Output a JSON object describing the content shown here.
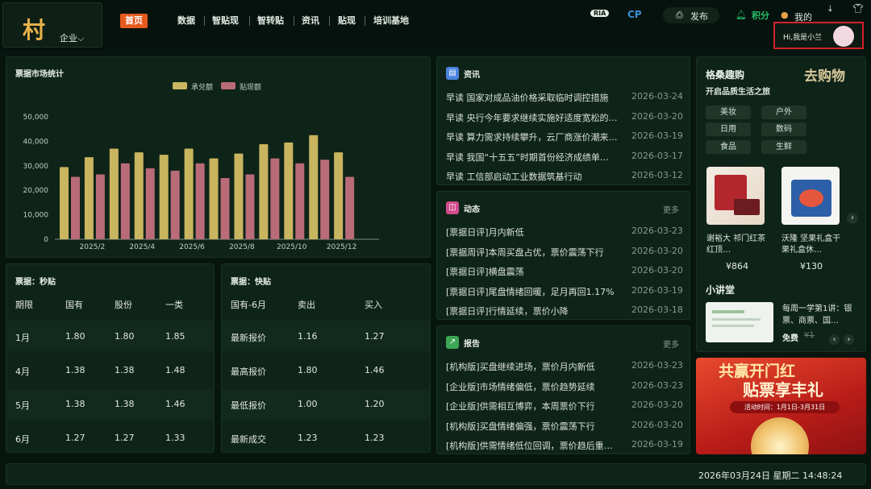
{
  "header": {
    "logo_glyph": "村",
    "logo_label": "企业",
    "nav": [
      "首页",
      "数据",
      "智贴现",
      "智转贴",
      "资讯",
      "贴现",
      "培训基地"
    ],
    "ria": "RIA",
    "cp": "CP",
    "publish": "发布",
    "vip": "积分",
    "mine": "我的",
    "greeting": "Hi,我是小兰"
  },
  "chart_panel": {
    "title": "票据市场统计",
    "legend": [
      "承兑额",
      "贴现额"
    ]
  },
  "chart_data": {
    "type": "bar",
    "title": "票据市场统计",
    "categories": [
      "2025/1",
      "2025/2",
      "2025/3",
      "2025/4",
      "2025/5",
      "2025/6",
      "2025/7",
      "2025/8",
      "2025/9",
      "2025/10",
      "2025/11",
      "2025/12",
      "2026/1"
    ],
    "x_tick_labels": [
      "2025/2",
      "2025/4",
      "2025/6",
      "2025/8",
      "2025/10",
      "2025/12"
    ],
    "series": [
      {
        "name": "承兑额",
        "color": "#c9b55f",
        "values": [
          29500,
          33500,
          37000,
          35500,
          34500,
          37000,
          33000,
          35000,
          38800,
          39500,
          42500,
          35500,
          0
        ]
      },
      {
        "name": "贴现额",
        "color": "#b96b78",
        "values": [
          25500,
          26500,
          31000,
          29000,
          28000,
          31000,
          25000,
          26500,
          33000,
          31000,
          32500,
          25500,
          0
        ]
      }
    ],
    "ylim": [
      0,
      50000
    ],
    "y_ticks": [
      "0",
      "10,000",
      "20,000",
      "30,000",
      "40,000",
      "50,000"
    ],
    "grid": false,
    "legend_position": "top-center"
  },
  "miaotie": {
    "title": "票据：秒贴",
    "headers": [
      "期限",
      "国有",
      "股份",
      "一类"
    ],
    "rows": [
      [
        "1月",
        "1.80",
        "1.80",
        "1.85"
      ],
      [
        "4月",
        "1.38",
        "1.38",
        "1.48"
      ],
      [
        "5月",
        "1.38",
        "1.38",
        "1.46"
      ],
      [
        "6月",
        "1.27",
        "1.27",
        "1.33"
      ]
    ]
  },
  "kuaitie": {
    "title": "票据：快贴",
    "headers": [
      "国有-6月",
      "卖出",
      "买入"
    ],
    "rows": [
      [
        "最新报价",
        "1.16",
        "1.27"
      ],
      [
        "最高报价",
        "1.80",
        "1.46"
      ],
      [
        "最低报价",
        "1.00",
        "1.20"
      ],
      [
        "最新成交",
        "1.23",
        "1.23"
      ]
    ]
  },
  "news": {
    "title": "资讯",
    "items": [
      {
        "text": "早读 国家对成品油价格采取临时调控措施",
        "date": "2026-03-24"
      },
      {
        "text": "早读 央行今年要求继续实施好适度宽松的…",
        "date": "2026-03-20"
      },
      {
        "text": "早读 算力需求持续攀升，云厂商涨价潮来…",
        "date": "2026-03-19"
      },
      {
        "text": "早读 我国“十五五”时期首份经济成绩单…",
        "date": "2026-03-17"
      },
      {
        "text": "早读 工信部启动工业数据筑基行动",
        "date": "2026-03-12"
      }
    ]
  },
  "dynamics": {
    "title": "动态",
    "more": "更多",
    "items": [
      {
        "text": "[票据日评]月内新低",
        "date": "2026-03-23"
      },
      {
        "text": "[票据周评]本周买盘占优，票价震荡下行",
        "date": "2026-03-20"
      },
      {
        "text": "[票据日评]横盘震荡",
        "date": "2026-03-20"
      },
      {
        "text": "[票据日评]尾盘情绪回暖，足月再回1.17%",
        "date": "2026-03-19"
      },
      {
        "text": "[票据日评]行情延续，票价小降",
        "date": "2026-03-18"
      }
    ]
  },
  "reports": {
    "title": "报告",
    "more": "更多",
    "items": [
      {
        "text": "[机构版]买盘继续进场，票价月内新低",
        "date": "2026-03-23"
      },
      {
        "text": "[企业版]市场情绪偏低，票价趋势延续",
        "date": "2026-03-23"
      },
      {
        "text": "[企业版]供需相互博弈，本周票价下行",
        "date": "2026-03-20"
      },
      {
        "text": "[机构版]买盘情绪偏强，票价震荡下行",
        "date": "2026-03-20"
      },
      {
        "text": "[机构版]供需情绪低位回调，票价趋后重…",
        "date": "2026-03-19"
      }
    ]
  },
  "shop": {
    "title": "格桑趣购",
    "subtitle": "开启品质生活之旅",
    "brand": "去购物",
    "tags": [
      "美妆",
      "户外",
      "日用",
      "数码",
      "食品",
      "生鲜"
    ],
    "products": [
      {
        "name": "谢裕大 祁门红茶红顶…",
        "price": "¥864",
        "img_color": "#b3262d"
      },
      {
        "name": "沃隆 坚果礼盒干果礼盒休…",
        "price": "¥130",
        "img_color": "#2d5fa8"
      }
    ],
    "course_title": "小讲堂",
    "course_name": "每周一学第1讲：银票、商票、国…",
    "course_price": "免费",
    "course_old": "¥1"
  },
  "banner": {
    "line1": "共赢开门红",
    "line2": "贴票享丰礼",
    "period": "活动时间：1月1日-3月31日"
  },
  "footer": {
    "datetime": "2026年03月24日 星期二 14:48:24"
  }
}
